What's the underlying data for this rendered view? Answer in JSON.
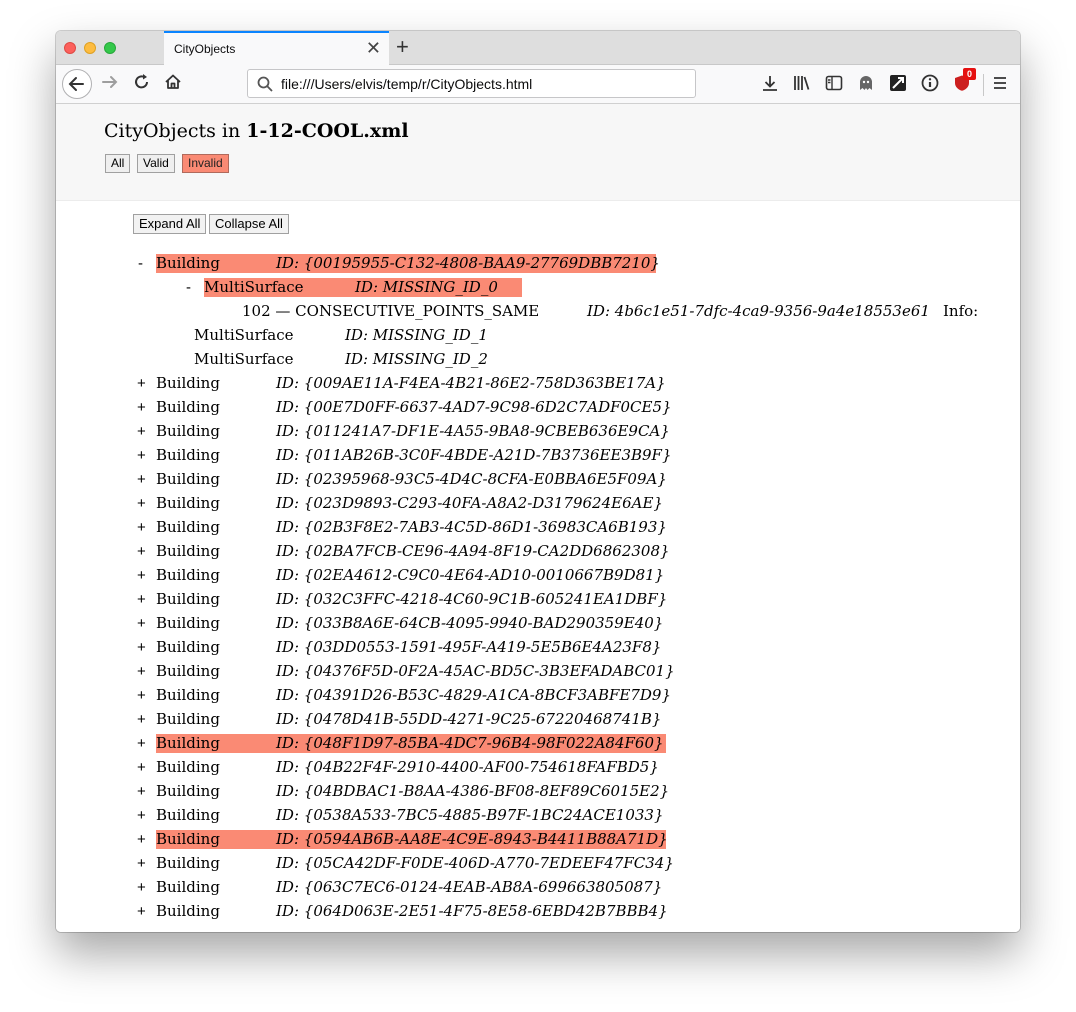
{
  "browser": {
    "tab_title": "CityObjects",
    "url": "file:///Users/elvis/temp/r/CityObjects.html",
    "badge_count": "0"
  },
  "page": {
    "title_prefix": "CityObjects in ",
    "title_file": "1-12-COOL.xml",
    "filters": [
      "All",
      "Valid",
      "Invalid"
    ],
    "active_filter": "Invalid",
    "expand_all": "Expand All",
    "collapse_all": "Collapse All"
  },
  "tree": {
    "first": {
      "toggle": "-",
      "type": "Building",
      "id": "ID: {00195955-C132-4808-BAA9-27769DBB7210}",
      "children": [
        {
          "toggle": "-",
          "type": "MultiSurface",
          "id": "ID: MISSING_ID_0",
          "invalid": true,
          "error": {
            "code": "102 — CONSECUTIVE_POINTS_SAME",
            "id": "ID: 4b6c1e51-7dfc-4ca9-9356-9a4e18553e61",
            "info": "Info:"
          }
        },
        {
          "type": "MultiSurface",
          "id": "ID: MISSING_ID_1"
        },
        {
          "type": "MultiSurface",
          "id": "ID: MISSING_ID_2"
        }
      ]
    },
    "buildings": [
      {
        "type": "Building",
        "id": "ID: {009AE11A-F4EA-4B21-86E2-758D363BE17A}",
        "invalid": false
      },
      {
        "type": "Building",
        "id": "ID: {00E7D0FF-6637-4AD7-9C98-6D2C7ADF0CE5}",
        "invalid": false
      },
      {
        "type": "Building",
        "id": "ID: {011241A7-DF1E-4A55-9BA8-9CBEB636E9CA}",
        "invalid": false
      },
      {
        "type": "Building",
        "id": "ID: {011AB26B-3C0F-4BDE-A21D-7B3736EE3B9F}",
        "invalid": false
      },
      {
        "type": "Building",
        "id": "ID: {02395968-93C5-4D4C-8CFA-E0BBA6E5F09A}",
        "invalid": false
      },
      {
        "type": "Building",
        "id": "ID: {023D9893-C293-40FA-A8A2-D3179624E6AE}",
        "invalid": false
      },
      {
        "type": "Building",
        "id": "ID: {02B3F8E2-7AB3-4C5D-86D1-36983CA6B193}",
        "invalid": false
      },
      {
        "type": "Building",
        "id": "ID: {02BA7FCB-CE96-4A94-8F19-CA2DD6862308}",
        "invalid": false
      },
      {
        "type": "Building",
        "id": "ID: {02EA4612-C9C0-4E64-AD10-0010667B9D81}",
        "invalid": false
      },
      {
        "type": "Building",
        "id": "ID: {032C3FFC-4218-4C60-9C1B-605241EA1DBF}",
        "invalid": false
      },
      {
        "type": "Building",
        "id": "ID: {033B8A6E-64CB-4095-9940-BAD290359E40}",
        "invalid": false
      },
      {
        "type": "Building",
        "id": "ID: {03DD0553-1591-495F-A419-5E5B6E4A23F8}",
        "invalid": false
      },
      {
        "type": "Building",
        "id": "ID: {04376F5D-0F2A-45AC-BD5C-3B3EFADABC01}",
        "invalid": false
      },
      {
        "type": "Building",
        "id": "ID: {04391D26-B53C-4829-A1CA-8BCF3ABFE7D9}",
        "invalid": false
      },
      {
        "type": "Building",
        "id": "ID: {0478D41B-55DD-4271-9C25-67220468741B}",
        "invalid": false
      },
      {
        "type": "Building",
        "id": "ID: {048F1D97-85BA-4DC7-96B4-98F022A84F60}",
        "invalid": true
      },
      {
        "type": "Building",
        "id": "ID: {04B22F4F-2910-4400-AF00-754618FAFBD5}",
        "invalid": false
      },
      {
        "type": "Building",
        "id": "ID: {04BDBAC1-B8AA-4386-BF08-8EF89C6015E2}",
        "invalid": false
      },
      {
        "type": "Building",
        "id": "ID: {0538A533-7BC5-4885-B97F-1BC24ACE1033}",
        "invalid": false
      },
      {
        "type": "Building",
        "id": "ID: {0594AB6B-AA8E-4C9E-8943-B4411B88A71D}",
        "invalid": true
      },
      {
        "type": "Building",
        "id": "ID: {05CA42DF-F0DE-406D-A770-7EDEEF47FC34}",
        "invalid": false
      },
      {
        "type": "Building",
        "id": "ID: {063C7EC6-0124-4EAB-AB8A-699663805087}",
        "invalid": false
      },
      {
        "type": "Building",
        "id": "ID: {064D063E-2E51-4F75-8E58-6EBD42B7BBB4}",
        "invalid": false
      }
    ],
    "collapsed_toggle": "+"
  },
  "colors": {
    "invalid_highlight": "#fa8a74",
    "tab_accent": "#0a84ff"
  }
}
